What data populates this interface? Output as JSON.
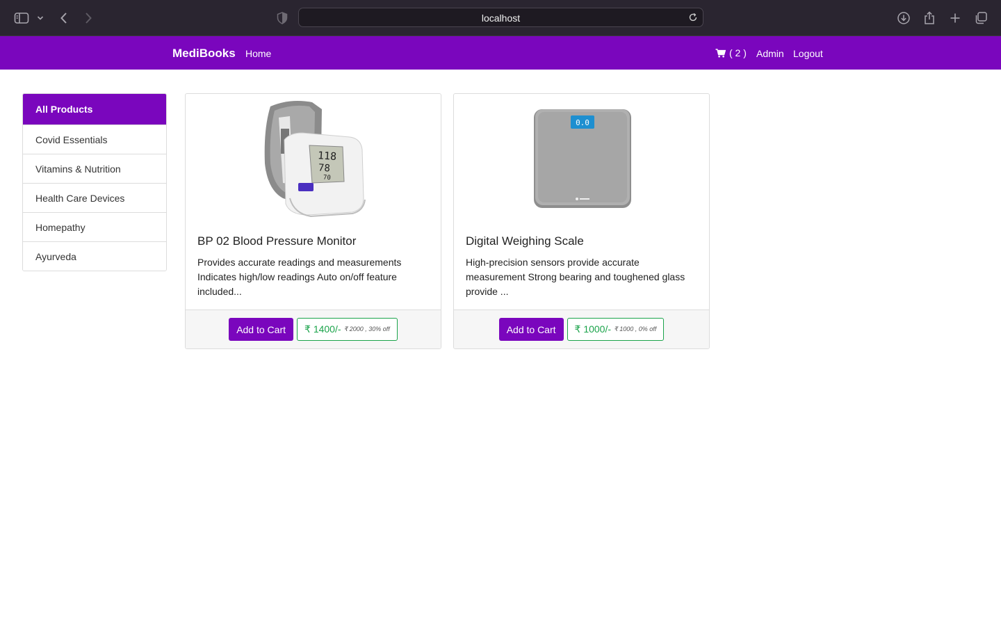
{
  "browser": {
    "url": "localhost"
  },
  "navbar": {
    "brand": "MediBooks",
    "home": "Home",
    "cart_count": "( 2 )",
    "admin": "Admin",
    "logout": "Logout"
  },
  "sidebar": {
    "items": [
      {
        "label": "All Products"
      },
      {
        "label": "Covid Essentials"
      },
      {
        "label": "Vitamins & Nutrition"
      },
      {
        "label": "Health Care Devices"
      },
      {
        "label": "Homepathy"
      },
      {
        "label": "Ayurveda"
      }
    ]
  },
  "products": [
    {
      "title": "BP 02 Blood Pressure Monitor",
      "description": "Provides accurate readings and measurements Indicates high/low readings Auto on/off feature included...",
      "button": "Add to Cart",
      "price": "₹ 1400/-",
      "price_detail": "₹ 2000 , 30% off",
      "image": "blood-pressure-monitor",
      "monitor_readings": [
        "118",
        "78",
        "70"
      ]
    },
    {
      "title": "Digital Weighing Scale",
      "description": "High-precision sensors provide accurate measurement Strong bearing and toughened glass provide ...",
      "button": "Add to Cart",
      "price": "₹ 1000/-",
      "price_detail": "₹ 1000 , 0% off",
      "image": "weighing-scale",
      "scale_display": "0.0"
    }
  ],
  "colors": {
    "brand": "#7a06bd",
    "price": "#1aa34a"
  }
}
